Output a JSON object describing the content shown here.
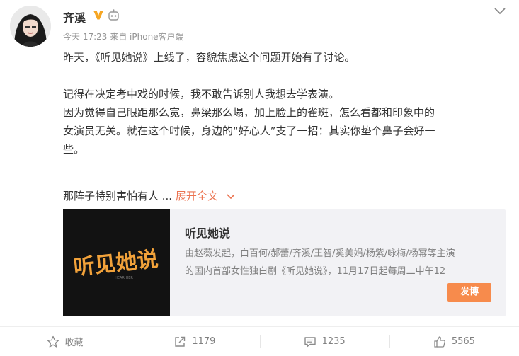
{
  "user": {
    "name": "齐溪"
  },
  "meta": {
    "time": "今天 17:23",
    "source": "来自 iPhone客户端"
  },
  "post": {
    "lines": [
      "昨天，《听见她说》上线了，容貌焦虑这个问题开始有了讨论。",
      "",
      "记得在决定考中戏的时候，我不敢告诉别人我想去学表演。",
      "因为觉得自己眼距那么宽，鼻梁那么塌，加上脸上的雀斑，怎么看都和印象中的",
      "女演员无关。就在这个时候，身边的“好心人”支了一招：其实你垫个鼻子会好一",
      "些。",
      ""
    ],
    "truncated_text": "那阵子特别害怕有人 ... ",
    "expand_label": "展开全文"
  },
  "card": {
    "title": "听见她说",
    "desc_line1": "由赵薇发起，白百何/郝蕾/齐溪/王智/奚美娟/杨紫/咏梅/杨幂等主演",
    "desc_line2": "的国内首部女性独白剧《听见她说》，11月17日起每周二中午12",
    "button_label": "发博",
    "image_text": "听见她说",
    "image_subtext": "HEAR HER"
  },
  "actions": {
    "favorite_label": "收藏",
    "repost_count": "1179",
    "comment_count": "1235",
    "like_count": "5565"
  },
  "colors": {
    "accent": "#eb7350",
    "button": "#f78b4c",
    "verified": "#f6a623",
    "gold_text": "#f2a23a"
  }
}
